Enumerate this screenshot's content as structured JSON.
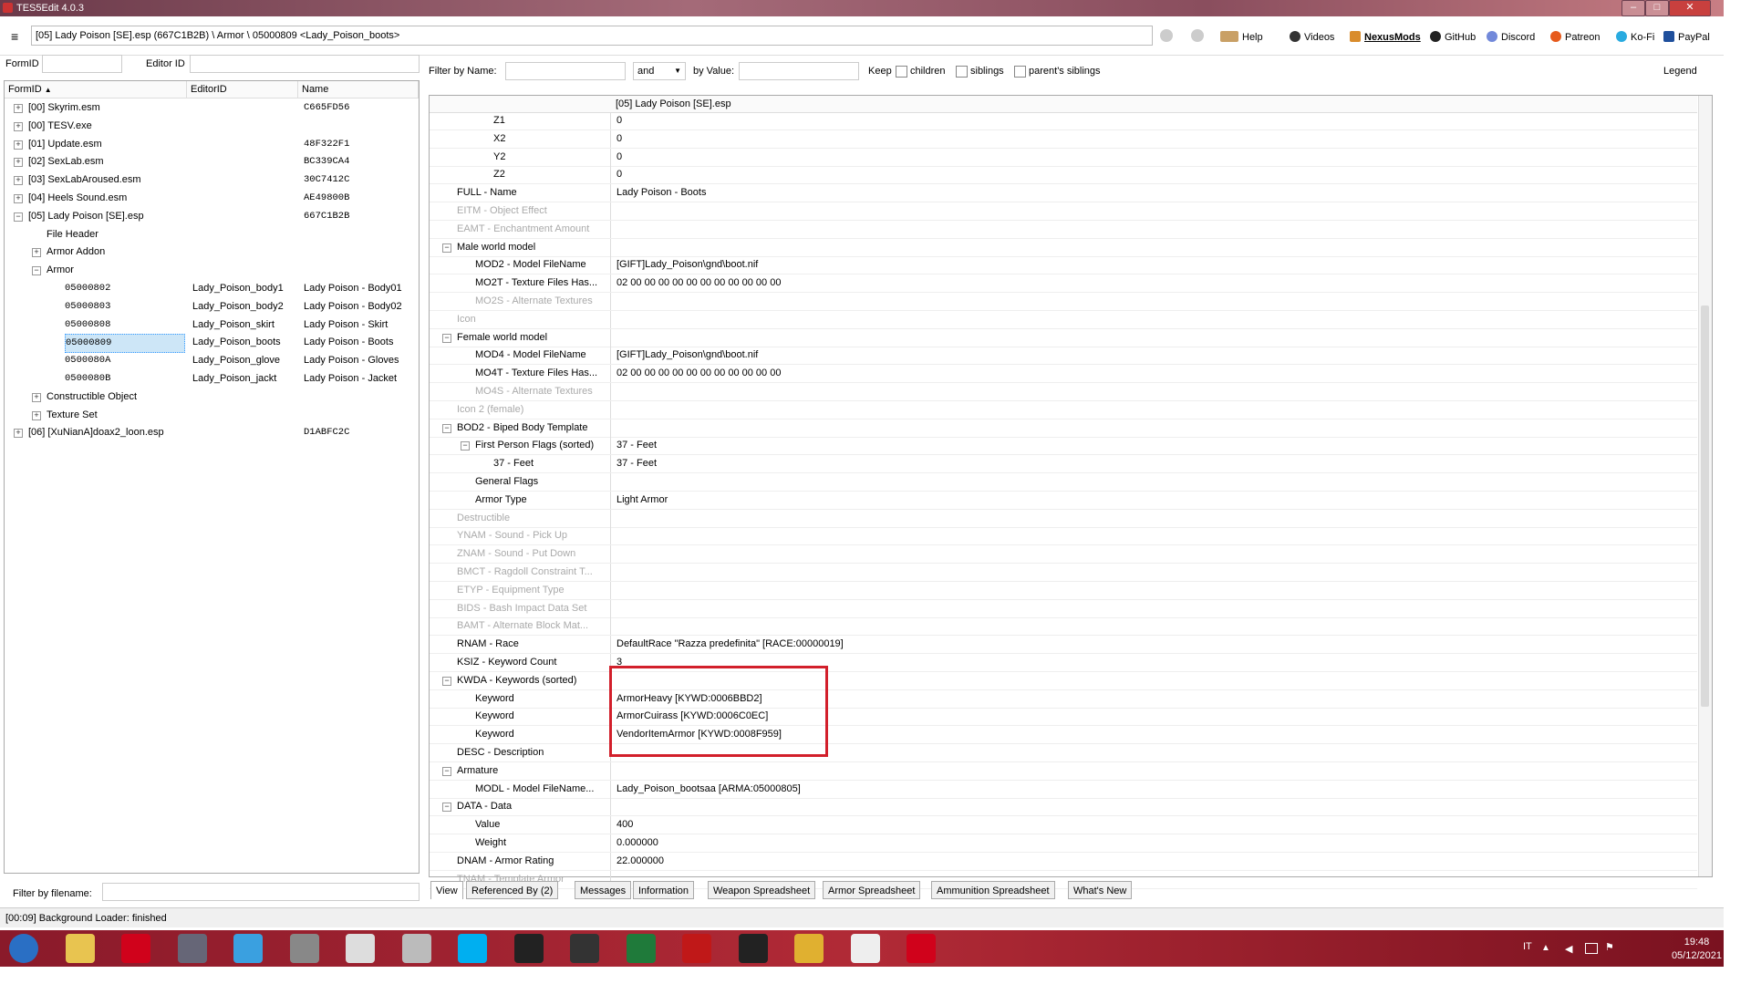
{
  "window": {
    "title": "TES5Edit 4.0.3"
  },
  "toolbar": {
    "path": "[05] Lady Poison [SE].esp (667C1B2B) \\ Armor \\ 05000809 <Lady_Poison_boots>",
    "links": [
      "Help",
      "Videos",
      "NexusMods",
      "GitHub",
      "Discord",
      "Patreon",
      "Ko-Fi",
      "PayPal"
    ]
  },
  "left": {
    "formid_label": "FormID",
    "editorid_label": "Editor ID",
    "headers": [
      "FormID",
      "EditorID",
      "Name"
    ],
    "rows": [
      {
        "indent": 0,
        "exp": "+",
        "formid": "[00] Skyrim.esm",
        "editorid": "",
        "name": "C665FD56",
        "mono": true
      },
      {
        "indent": 0,
        "exp": "+",
        "formid": "[00] TESV.exe",
        "editorid": "",
        "name": "",
        "mono": false
      },
      {
        "indent": 0,
        "exp": "+",
        "formid": "[01] Update.esm",
        "editorid": "",
        "name": "48F322F1",
        "mono": true
      },
      {
        "indent": 0,
        "exp": "+",
        "formid": "[02] SexLab.esm",
        "editorid": "",
        "name": "BC339CA4",
        "mono": true
      },
      {
        "indent": 0,
        "exp": "+",
        "formid": "[03] SexLabAroused.esm",
        "editorid": "",
        "name": "30C7412C",
        "mono": true
      },
      {
        "indent": 0,
        "exp": "+",
        "formid": "[04] Heels Sound.esm",
        "editorid": "",
        "name": "AE49800B",
        "mono": true
      },
      {
        "indent": 0,
        "exp": "-",
        "formid": "[05] Lady Poison [SE].esp",
        "editorid": "",
        "name": "667C1B2B",
        "mono": true
      },
      {
        "indent": 1,
        "exp": "",
        "formid": "File Header",
        "editorid": "",
        "name": "",
        "mono": false
      },
      {
        "indent": 1,
        "exp": "+",
        "formid": "Armor Addon",
        "editorid": "",
        "name": "",
        "mono": false
      },
      {
        "indent": 1,
        "exp": "-",
        "formid": "Armor",
        "editorid": "",
        "name": "",
        "mono": false
      },
      {
        "indent": 2,
        "exp": "",
        "formid": "05000802",
        "editorid": "Lady_Poison_body1",
        "name": "Lady Poison - Body01",
        "mono": false,
        "idmono": true
      },
      {
        "indent": 2,
        "exp": "",
        "formid": "05000803",
        "editorid": "Lady_Poison_body2",
        "name": "Lady Poison - Body02",
        "mono": false,
        "idmono": true
      },
      {
        "indent": 2,
        "exp": "",
        "formid": "05000808",
        "editorid": "Lady_Poison_skirt",
        "name": "Lady Poison - Skirt",
        "mono": false,
        "idmono": true
      },
      {
        "indent": 2,
        "exp": "",
        "formid": "05000809",
        "editorid": "Lady_Poison_boots",
        "name": "Lady Poison - Boots",
        "mono": false,
        "idmono": true,
        "sel": true
      },
      {
        "indent": 2,
        "exp": "",
        "formid": "0500080A",
        "editorid": "Lady_Poison_glove",
        "name": "Lady Poison - Gloves",
        "mono": false,
        "idmono": true
      },
      {
        "indent": 2,
        "exp": "",
        "formid": "0500080B",
        "editorid": "Lady_Poison_jackt",
        "name": "Lady Poison - Jacket",
        "mono": false,
        "idmono": true
      },
      {
        "indent": 1,
        "exp": "+",
        "formid": "Constructible Object",
        "editorid": "",
        "name": "",
        "mono": false
      },
      {
        "indent": 1,
        "exp": "+",
        "formid": "Texture Set",
        "editorid": "",
        "name": "",
        "mono": false
      },
      {
        "indent": 0,
        "exp": "+",
        "formid": "[06] [XuNianA]doax2_loon.esp",
        "editorid": "",
        "name": "D1ABFC2C",
        "mono": true
      }
    ],
    "filter_label": "Filter by filename:"
  },
  "filter": {
    "by_name": "Filter by Name:",
    "and": "and",
    "by_value": "by Value:",
    "keep": "Keep",
    "children": "children",
    "siblings": "siblings",
    "parents": "parent's siblings",
    "legend": "Legend"
  },
  "right": {
    "column_header": "[05] Lady Poison [SE].esp",
    "rows": [
      {
        "d": 2,
        "exp": "",
        "k": "Z1",
        "v": "0",
        "grey": false
      },
      {
        "d": 2,
        "exp": "",
        "k": "X2",
        "v": "0",
        "grey": false
      },
      {
        "d": 2,
        "exp": "",
        "k": "Y2",
        "v": "0",
        "grey": false
      },
      {
        "d": 2,
        "exp": "",
        "k": "Z2",
        "v": "0",
        "grey": false
      },
      {
        "d": 0,
        "exp": "",
        "k": "FULL - Name",
        "v": "Lady Poison - Boots",
        "grey": false
      },
      {
        "d": 0,
        "exp": "",
        "k": "EITM - Object Effect",
        "v": "",
        "grey": true
      },
      {
        "d": 0,
        "exp": "",
        "k": "EAMT - Enchantment Amount",
        "v": "",
        "grey": true
      },
      {
        "d": 0,
        "exp": "-",
        "k": "Male world model",
        "v": "",
        "grey": false
      },
      {
        "d": 1,
        "exp": "",
        "k": "MOD2 - Model FileName",
        "v": "[GIFT]Lady_Poison\\gnd\\boot.nif",
        "grey": false
      },
      {
        "d": 1,
        "exp": "",
        "k": "MO2T - Texture Files Has...",
        "v": "02 00 00 00 00 00 00 00 00 00 00 00",
        "grey": false
      },
      {
        "d": 1,
        "exp": "",
        "k": "MO2S - Alternate Textures",
        "v": "",
        "grey": true
      },
      {
        "d": 0,
        "exp": "",
        "k": "Icon",
        "v": "",
        "grey": true
      },
      {
        "d": 0,
        "exp": "-",
        "k": "Female world model",
        "v": "",
        "grey": false
      },
      {
        "d": 1,
        "exp": "",
        "k": "MOD4 - Model FileName",
        "v": "[GIFT]Lady_Poison\\gnd\\boot.nif",
        "grey": false
      },
      {
        "d": 1,
        "exp": "",
        "k": "MO4T - Texture Files Has...",
        "v": "02 00 00 00 00 00 00 00 00 00 00 00",
        "grey": false
      },
      {
        "d": 1,
        "exp": "",
        "k": "MO4S - Alternate Textures",
        "v": "",
        "grey": true
      },
      {
        "d": 0,
        "exp": "",
        "k": "Icon 2 (female)",
        "v": "",
        "grey": true
      },
      {
        "d": 0,
        "exp": "-",
        "k": "BOD2 - Biped Body Template",
        "v": "",
        "grey": false
      },
      {
        "d": 1,
        "exp": "-",
        "k": "First Person Flags (sorted)",
        "v": "37 - Feet",
        "grey": false
      },
      {
        "d": 2,
        "exp": "",
        "k": "37 - Feet",
        "v": "37 - Feet",
        "grey": false
      },
      {
        "d": 1,
        "exp": "",
        "k": "General Flags",
        "v": "",
        "grey": false
      },
      {
        "d": 1,
        "exp": "",
        "k": "Armor Type",
        "v": "Light Armor",
        "grey": false
      },
      {
        "d": 0,
        "exp": "",
        "k": "Destructible",
        "v": "",
        "grey": true
      },
      {
        "d": 0,
        "exp": "",
        "k": "YNAM - Sound - Pick Up",
        "v": "",
        "grey": true
      },
      {
        "d": 0,
        "exp": "",
        "k": "ZNAM - Sound - Put Down",
        "v": "",
        "grey": true
      },
      {
        "d": 0,
        "exp": "",
        "k": "BMCT - Ragdoll Constraint T...",
        "v": "",
        "grey": true
      },
      {
        "d": 0,
        "exp": "",
        "k": "ETYP - Equipment Type",
        "v": "",
        "grey": true
      },
      {
        "d": 0,
        "exp": "",
        "k": "BIDS - Bash Impact Data Set",
        "v": "",
        "grey": true
      },
      {
        "d": 0,
        "exp": "",
        "k": "BAMT - Alternate Block Mat...",
        "v": "",
        "grey": true
      },
      {
        "d": 0,
        "exp": "",
        "k": "RNAM - Race",
        "v": "DefaultRace \"Razza predefinita\" [RACE:00000019]",
        "grey": false
      },
      {
        "d": 0,
        "exp": "",
        "k": "KSIZ - Keyword Count",
        "v": "3",
        "grey": false
      },
      {
        "d": 0,
        "exp": "-",
        "k": "KWDA - Keywords (sorted)",
        "v": "",
        "grey": false
      },
      {
        "d": 1,
        "exp": "",
        "k": "Keyword",
        "v": "ArmorHeavy [KYWD:0006BBD2]",
        "grey": false
      },
      {
        "d": 1,
        "exp": "",
        "k": "Keyword",
        "v": "ArmorCuirass [KYWD:0006C0EC]",
        "grey": false
      },
      {
        "d": 1,
        "exp": "",
        "k": "Keyword",
        "v": "VendorItemArmor [KYWD:0008F959]",
        "grey": false
      },
      {
        "d": 0,
        "exp": "",
        "k": "DESC - Description",
        "v": "",
        "grey": false
      },
      {
        "d": 0,
        "exp": "-",
        "k": "Armature",
        "v": "",
        "grey": false
      },
      {
        "d": 1,
        "exp": "",
        "k": "MODL - Model FileName...",
        "v": "Lady_Poison_bootsaa [ARMA:05000805]",
        "grey": false
      },
      {
        "d": 0,
        "exp": "-",
        "k": "DATA - Data",
        "v": "",
        "grey": false
      },
      {
        "d": 1,
        "exp": "",
        "k": "Value",
        "v": "400",
        "grey": false
      },
      {
        "d": 1,
        "exp": "",
        "k": "Weight",
        "v": "0.000000",
        "grey": false
      },
      {
        "d": 0,
        "exp": "",
        "k": "DNAM - Armor Rating",
        "v": "22.000000",
        "grey": false
      },
      {
        "d": 0,
        "exp": "",
        "k": "TNAM - Template Armor",
        "v": "",
        "grey": true
      }
    ]
  },
  "tabs": [
    "View",
    "Referenced By (2)",
    "Messages",
    "Information",
    "Weapon Spreadsheet",
    "Armor Spreadsheet",
    "Ammunition Spreadsheet",
    "What's New"
  ],
  "status": "[00:09] Background Loader: finished",
  "taskbar": {
    "lang": "IT",
    "time": "19:48",
    "date": "05/12/2021",
    "icons": [
      {
        "name": "start-orb-icon",
        "color": "#2a6fc4"
      },
      {
        "name": "explorer-icon",
        "color": "#e8c450"
      },
      {
        "name": "opera-icon",
        "color": "#d0021b"
      },
      {
        "name": "media-center-icon",
        "color": "#667"
      },
      {
        "name": "itunes-icon",
        "color": "#3aa0e0"
      },
      {
        "name": "audio-icon",
        "color": "#888"
      },
      {
        "name": "ffdec-icon",
        "color": "#ddd"
      },
      {
        "name": "app-icon",
        "color": "#bbb"
      },
      {
        "name": "skype-icon",
        "color": "#00aff0"
      },
      {
        "name": "mod-manager-icon",
        "color": "#222"
      },
      {
        "name": "xedit-icon",
        "color": "#333"
      },
      {
        "name": "excel-icon",
        "color": "#1f7a3a"
      },
      {
        "name": "flash-icon",
        "color": "#c01818"
      },
      {
        "name": "game-icon",
        "color": "#222"
      },
      {
        "name": "chart-app-icon",
        "color": "#e0b030"
      },
      {
        "name": "skyrim-icon",
        "color": "#eee"
      },
      {
        "name": "opera-active-icon",
        "color": "#d0021b"
      }
    ]
  },
  "accent": "#d21f2b"
}
